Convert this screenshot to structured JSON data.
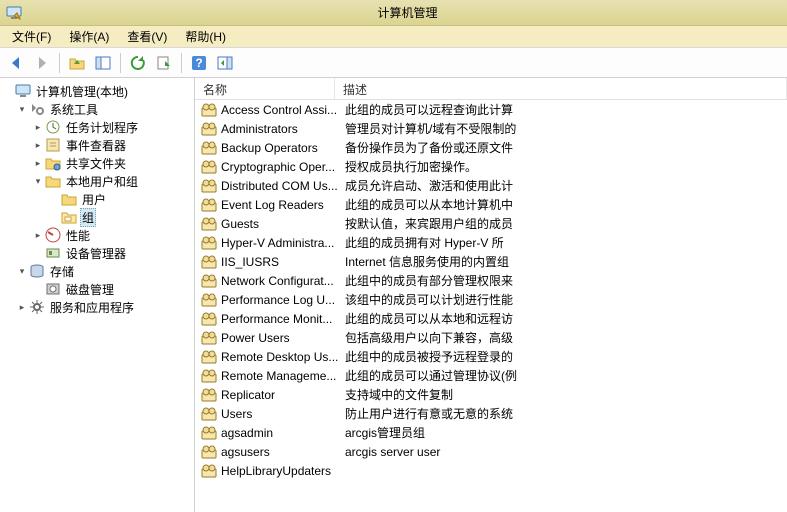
{
  "window": {
    "title": "计算机管理"
  },
  "menu": {
    "file": "文件(F)",
    "action": "操作(A)",
    "view": "查看(V)",
    "help": "帮助(H)"
  },
  "toolbar_icons": {
    "back": "back-arrow",
    "forward": "forward-arrow",
    "up": "folder-up",
    "panes": "show-panes",
    "refresh": "refresh",
    "export": "export-list",
    "help": "help",
    "actions": "action-pane"
  },
  "tree": {
    "root": "计算机管理(本地)",
    "system_tools": "系统工具",
    "task_scheduler": "任务计划程序",
    "event_viewer": "事件查看器",
    "shared_folders": "共享文件夹",
    "local_users_groups": "本地用户和组",
    "users": "用户",
    "groups": "组",
    "performance": "性能",
    "device_manager": "设备管理器",
    "storage": "存储",
    "disk_mgmt": "磁盘管理",
    "services_apps": "服务和应用程序"
  },
  "columns": {
    "name": "名称",
    "desc": "描述"
  },
  "groups": [
    {
      "name": "Access Control Assi...",
      "desc": "此组的成员可以远程查询此计算"
    },
    {
      "name": "Administrators",
      "desc": "管理员对计算机/域有不受限制的"
    },
    {
      "name": "Backup Operators",
      "desc": "备份操作员为了备份或还原文件"
    },
    {
      "name": "Cryptographic Oper...",
      "desc": "授权成员执行加密操作。"
    },
    {
      "name": "Distributed COM Us...",
      "desc": "成员允许启动、激活和使用此计"
    },
    {
      "name": "Event Log Readers",
      "desc": "此组的成员可以从本地计算机中"
    },
    {
      "name": "Guests",
      "desc": "按默认值，来宾跟用户组的成员"
    },
    {
      "name": "Hyper-V Administra...",
      "desc": "此组的成员拥有对 Hyper-V 所"
    },
    {
      "name": "IIS_IUSRS",
      "desc": "Internet 信息服务使用的内置组"
    },
    {
      "name": "Network Configurat...",
      "desc": "此组中的成员有部分管理权限来"
    },
    {
      "name": "Performance Log U...",
      "desc": "该组中的成员可以计划进行性能"
    },
    {
      "name": "Performance Monit...",
      "desc": "此组的成员可以从本地和远程访"
    },
    {
      "name": "Power Users",
      "desc": "包括高级用户以向下兼容，高级"
    },
    {
      "name": "Remote Desktop Us...",
      "desc": "此组中的成员被授予远程登录的"
    },
    {
      "name": "Remote Manageme...",
      "desc": "此组的成员可以通过管理协议(例"
    },
    {
      "name": "Replicator",
      "desc": "支持域中的文件复制"
    },
    {
      "name": "Users",
      "desc": "防止用户进行有意或无意的系统"
    },
    {
      "name": "agsadmin",
      "desc": "arcgis管理员组"
    },
    {
      "name": "agsusers",
      "desc": "arcgis server user"
    },
    {
      "name": "HelpLibraryUpdaters",
      "desc": ""
    }
  ]
}
